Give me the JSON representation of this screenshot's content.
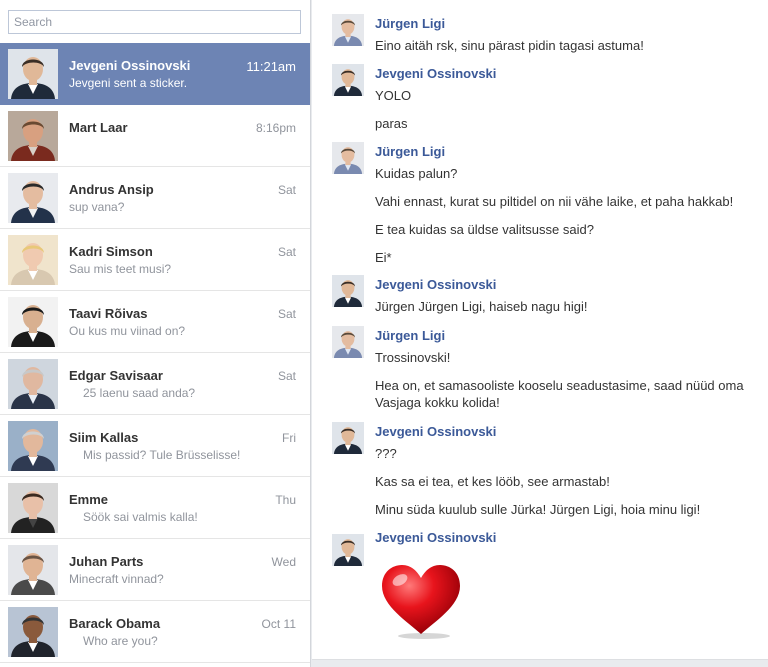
{
  "search": {
    "placeholder": "Search"
  },
  "conversations": [
    {
      "name": "Jevgeni Ossinovski",
      "snippet": "Jevgeni sent a sticker.",
      "time": "11:21am",
      "active": true
    },
    {
      "name": "Mart Laar",
      "snippet": "",
      "time": "8:16pm"
    },
    {
      "name": "Andrus Ansip",
      "snippet": "sup vana?",
      "time": "Sat"
    },
    {
      "name": "Kadri Simson",
      "snippet": "Sau mis teet musi?",
      "time": "Sat"
    },
    {
      "name": "Taavi Rõivas",
      "snippet": "Ou kus mu viinad on?",
      "time": "Sat"
    },
    {
      "name": "Edgar Savisaar",
      "snippet": "25 laenu saad anda?",
      "time": "Sat"
    },
    {
      "name": "Siim Kallas",
      "snippet": "Mis passid? Tule Brüsselisse!",
      "time": "Fri"
    },
    {
      "name": "Emme",
      "snippet": "Söök sai valmis kalla!",
      "time": "Thu"
    },
    {
      "name": "Juhan Parts",
      "snippet": "Minecraft vinnad?",
      "time": "Wed"
    },
    {
      "name": "Barack Obama",
      "snippet": "Who are you?",
      "time": "Oct 11"
    }
  ],
  "thread": [
    {
      "sender": "Jürgen Ligi",
      "messages": [
        "Eino aitäh rsk, sinu pärast pidin tagasi astuma!"
      ]
    },
    {
      "sender": "Jevgeni Ossinovski",
      "messages": [
        "YOLO",
        "paras"
      ]
    },
    {
      "sender": "Jürgen Ligi",
      "messages": [
        "Kuidas palun?",
        "Vahi ennast, kurat su piltidel on nii vähe laike, et paha hakkab!",
        "E tea kuidas sa üldse valitsusse said?",
        "Ei*"
      ]
    },
    {
      "sender": "Jevgeni Ossinovski",
      "messages": [
        "Jürgen Jürgen Ligi, haiseb nagu higi!"
      ]
    },
    {
      "sender": "Jürgen Ligi",
      "messages": [
        "Trossinovski!",
        "Hea on, et samasooliste kooselu seadustasime, saad nüüd oma",
        "Vasjaga kokku kolida!"
      ]
    },
    {
      "sender": "Jevgeni Ossinovski",
      "messages": [
        "???",
        "Kas sa ei tea, et kes lööb, see armastab!",
        "Minu süda kuulub sulle Jürka! Jürgen Ligi, hoia minu ligi!"
      ]
    },
    {
      "sender": "Jevgeni Ossinovski",
      "messages": []
    }
  ],
  "sticker": {
    "icon": "heart-sticker-icon",
    "color": "#e8141c"
  },
  "colors": {
    "active_row": "#6d84b4",
    "sender_name": "#3b5998"
  }
}
